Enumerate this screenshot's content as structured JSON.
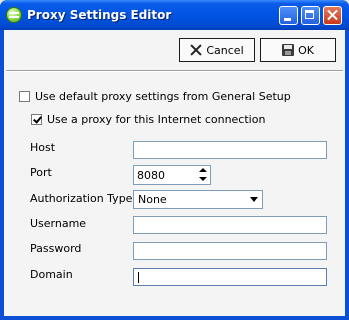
{
  "window": {
    "title": "Proxy Settings Editor"
  },
  "toolbar": {
    "cancel_label": "Cancel",
    "ok_label": "OK"
  },
  "options": {
    "use_default_label": "Use default proxy settings from General Setup",
    "use_default_checked": false,
    "use_proxy_label": "Use a proxy for this Internet connection",
    "use_proxy_checked": true
  },
  "form": {
    "host_label": "Host",
    "host_value": "",
    "port_label": "Port",
    "port_value": "8080",
    "auth_label": "Authorization Type",
    "auth_value": "None",
    "username_label": "Username",
    "username_value": "",
    "password_label": "Password",
    "password_value": "",
    "domain_label": "Domain",
    "domain_value": ""
  },
  "colors": {
    "titlebar": "#0054e3",
    "window_frame": "#0a4fd6",
    "client_bg": "#f4f4f4",
    "field_border": "#7f9db9"
  }
}
